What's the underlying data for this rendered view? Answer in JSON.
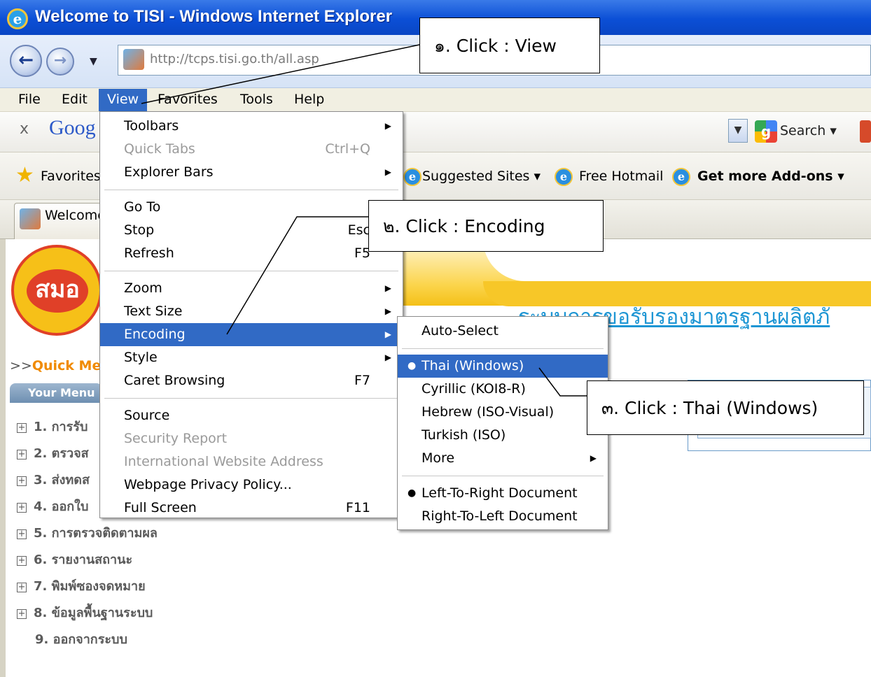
{
  "window": {
    "title": "Welcome to TISI - Windows Internet Explorer"
  },
  "address_bar": {
    "url": "http://tcps.tisi.go.th/all.asp"
  },
  "menubar": {
    "items": [
      "File",
      "Edit",
      "View",
      "Favorites",
      "Tools",
      "Help"
    ]
  },
  "google_toolbar": {
    "logo": "Goog",
    "search_label": "Search ▾"
  },
  "favorites_bar": {
    "favorites_label": "Favorites",
    "links": [
      "Suggested Sites ▾",
      "Free Hotmail",
      "Get more Add-ons ▾"
    ]
  },
  "tab": {
    "label": "Welcome"
  },
  "view_menu": {
    "items": [
      {
        "label": "Toolbars",
        "shortcut": "",
        "submenu": true,
        "disabled": false
      },
      {
        "label": "Quick Tabs",
        "shortcut": "Ctrl+Q",
        "submenu": false,
        "disabled": true
      },
      {
        "label": "Explorer Bars",
        "shortcut": "",
        "submenu": true,
        "disabled": false
      },
      {
        "label": "Go To",
        "shortcut": "",
        "submenu": true,
        "disabled": false
      },
      {
        "label": "Stop",
        "shortcut": "Esc",
        "submenu": false,
        "disabled": false
      },
      {
        "label": "Refresh",
        "shortcut": "F5",
        "submenu": false,
        "disabled": false
      },
      {
        "label": "Zoom",
        "shortcut": "",
        "submenu": true,
        "disabled": false
      },
      {
        "label": "Text Size",
        "shortcut": "",
        "submenu": true,
        "disabled": false
      },
      {
        "label": "Encoding",
        "shortcut": "",
        "submenu": true,
        "disabled": false
      },
      {
        "label": "Style",
        "shortcut": "",
        "submenu": true,
        "disabled": false
      },
      {
        "label": "Caret Browsing",
        "shortcut": "F7",
        "submenu": false,
        "disabled": false
      },
      {
        "label": "Source",
        "shortcut": "",
        "submenu": false,
        "disabled": false
      },
      {
        "label": "Security Report",
        "shortcut": "",
        "submenu": false,
        "disabled": true
      },
      {
        "label": "International Website Address",
        "shortcut": "",
        "submenu": false,
        "disabled": true
      },
      {
        "label": "Webpage Privacy Policy...",
        "shortcut": "",
        "submenu": false,
        "disabled": false
      },
      {
        "label": "Full Screen",
        "shortcut": "F11",
        "submenu": false,
        "disabled": false
      }
    ]
  },
  "encoding_menu": {
    "items": [
      {
        "label": "Auto-Select"
      },
      {
        "label": "Thai (Windows)",
        "checked": true
      },
      {
        "label": "Cyrillic (KOI8-R)"
      },
      {
        "label": "Hebrew (ISO-Visual)"
      },
      {
        "label": "Turkish (ISO)"
      },
      {
        "label": "More"
      },
      {
        "label": "Left-To-Right Document",
        "checked": true
      },
      {
        "label": "Right-To-Left Document"
      }
    ]
  },
  "page": {
    "logo_text": "สมอ",
    "site_title": "ระบบการขอรับรองมาตรฐานผลิตภั",
    "quick_menu_prefix": ">>",
    "quick_menu": "Quick Me",
    "your_menu": "Your Menu",
    "left_menu": [
      "1. การรับ",
      "2. ตรวจส",
      "3. ส่งทดส",
      "4. ออกใบ",
      "5. การตรวจติดตามผล",
      "6. รายงานสถานะ",
      "7. พิมพ์ซองจดหมาย",
      "8. ข้อมูลพื้นฐานระบบ",
      "9. ออกจากระบบ"
    ]
  },
  "callouts": {
    "step1": "๑. Click : View",
    "step2": "๒. Click : Encoding",
    "step3": "๓. Click : Thai (Windows)"
  },
  "colors": {
    "menu_highlight": "#316ac5",
    "titlebar": "#0b4fd6"
  }
}
